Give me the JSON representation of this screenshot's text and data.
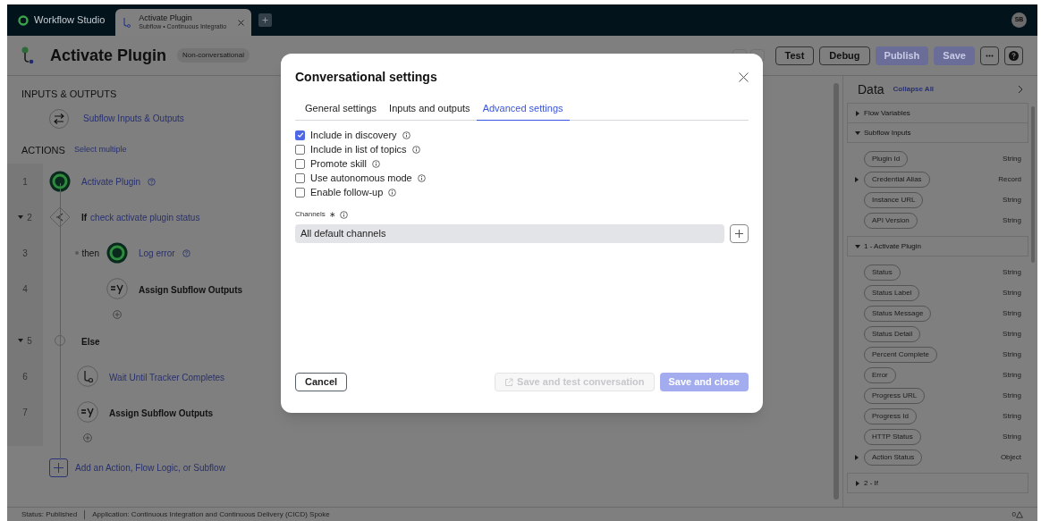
{
  "top_bar": {
    "app_name": "Workflow Studio",
    "tabs": [
      {
        "title": "Activate Plugin",
        "subtitle": "Subflow • Continuous Integratio",
        "selected": true
      }
    ],
    "avatar": "SB"
  },
  "header": {
    "title": "Activate Plugin",
    "badge": "Non-conversational",
    "buttons": [
      {
        "label": "Test",
        "disabled": false
      },
      {
        "label": "Debug",
        "disabled": false
      },
      {
        "label": "Publish",
        "disabled": true
      },
      {
        "label": "Save",
        "disabled": true
      }
    ]
  },
  "flow": {
    "inputs_heading": "INPUTS & OUTPUTS",
    "inputs_link": "Subflow Inputs & Outputs",
    "actions_heading": "ACTIONS",
    "select_multiple": "Select multiple",
    "actions": [
      {
        "number": "1",
        "kind": "action",
        "label": "Activate Plugin"
      },
      {
        "number": "2",
        "kind": "if",
        "prefix": "If",
        "label": "check activate plugin status",
        "expanded": true,
        "children": [
          {
            "number": "3",
            "kind": "action",
            "connector": "then",
            "label": "Log error"
          },
          {
            "number": "4",
            "kind": "assign",
            "label": "Assign Subflow Outputs"
          }
        ]
      },
      {
        "number": "5",
        "kind": "else",
        "label": "Else",
        "expanded": true,
        "children": [
          {
            "number": "6",
            "kind": "wait",
            "label": "Wait Until Tracker Completes"
          },
          {
            "number": "7",
            "kind": "assign",
            "label": "Assign Subflow Outputs"
          }
        ]
      }
    ],
    "add_label": "Add an Action, Flow Logic, or Subflow"
  },
  "data_panel": {
    "title": "Data",
    "collapse_all": "Collapse All",
    "sections": [
      {
        "title": "Flow Variables",
        "expanded": false
      },
      {
        "title": "Subflow Inputs",
        "expanded": true,
        "items": [
          {
            "label": "Plugin Id",
            "type": "String",
            "has_children": false
          },
          {
            "label": "Credential Alias",
            "type": "Record",
            "has_children": true
          },
          {
            "label": "Instance URL",
            "type": "String",
            "has_children": false
          },
          {
            "label": "API Version",
            "type": "String",
            "has_children": false
          }
        ]
      },
      {
        "title": "1 - Activate Plugin",
        "expanded": true,
        "items": [
          {
            "label": "Status",
            "type": "String",
            "has_children": false
          },
          {
            "label": "Status Label",
            "type": "String",
            "has_children": false
          },
          {
            "label": "Status Message",
            "type": "String",
            "has_children": false
          },
          {
            "label": "Status Detail",
            "type": "String",
            "has_children": false
          },
          {
            "label": "Percent Complete",
            "type": "String",
            "has_children": false
          },
          {
            "label": "Error",
            "type": "String",
            "has_children": false
          },
          {
            "label": "Progress URL",
            "type": "String",
            "has_children": false
          },
          {
            "label": "Progress Id",
            "type": "String",
            "has_children": false
          },
          {
            "label": "HTTP Status",
            "type": "String",
            "has_children": false
          },
          {
            "label": "Action Status",
            "type": "Object",
            "has_children": true
          }
        ]
      },
      {
        "title": "2 - If",
        "expanded": false
      }
    ]
  },
  "status_bar": {
    "status": "Status: Published",
    "application": "Application: Continuous Integration and Continuous Delivery (CICD) Spoke",
    "warnings": "0"
  },
  "modal": {
    "title": "Conversational settings",
    "tabs": [
      {
        "label": "General settings",
        "selected": false
      },
      {
        "label": "Inputs and outputs",
        "selected": false
      },
      {
        "label": "Advanced settings",
        "selected": true
      }
    ],
    "options": [
      {
        "label": "Include in discovery",
        "checked": true
      },
      {
        "label": "Include in list of topics",
        "checked": false
      },
      {
        "label": "Promote skill",
        "checked": false
      },
      {
        "label": "Use autonomous mode",
        "checked": false
      },
      {
        "label": "Enable follow-up",
        "checked": false
      }
    ],
    "channels": {
      "label": "Channels",
      "required_mark": "∗",
      "value": "All default channels"
    },
    "buttons": [
      {
        "label": "Cancel",
        "kind": "secondary",
        "disabled": false
      },
      {
        "label": "Save and test conversation",
        "kind": "external",
        "disabled": true
      },
      {
        "label": "Save and close",
        "kind": "primary",
        "disabled": true
      }
    ]
  }
}
